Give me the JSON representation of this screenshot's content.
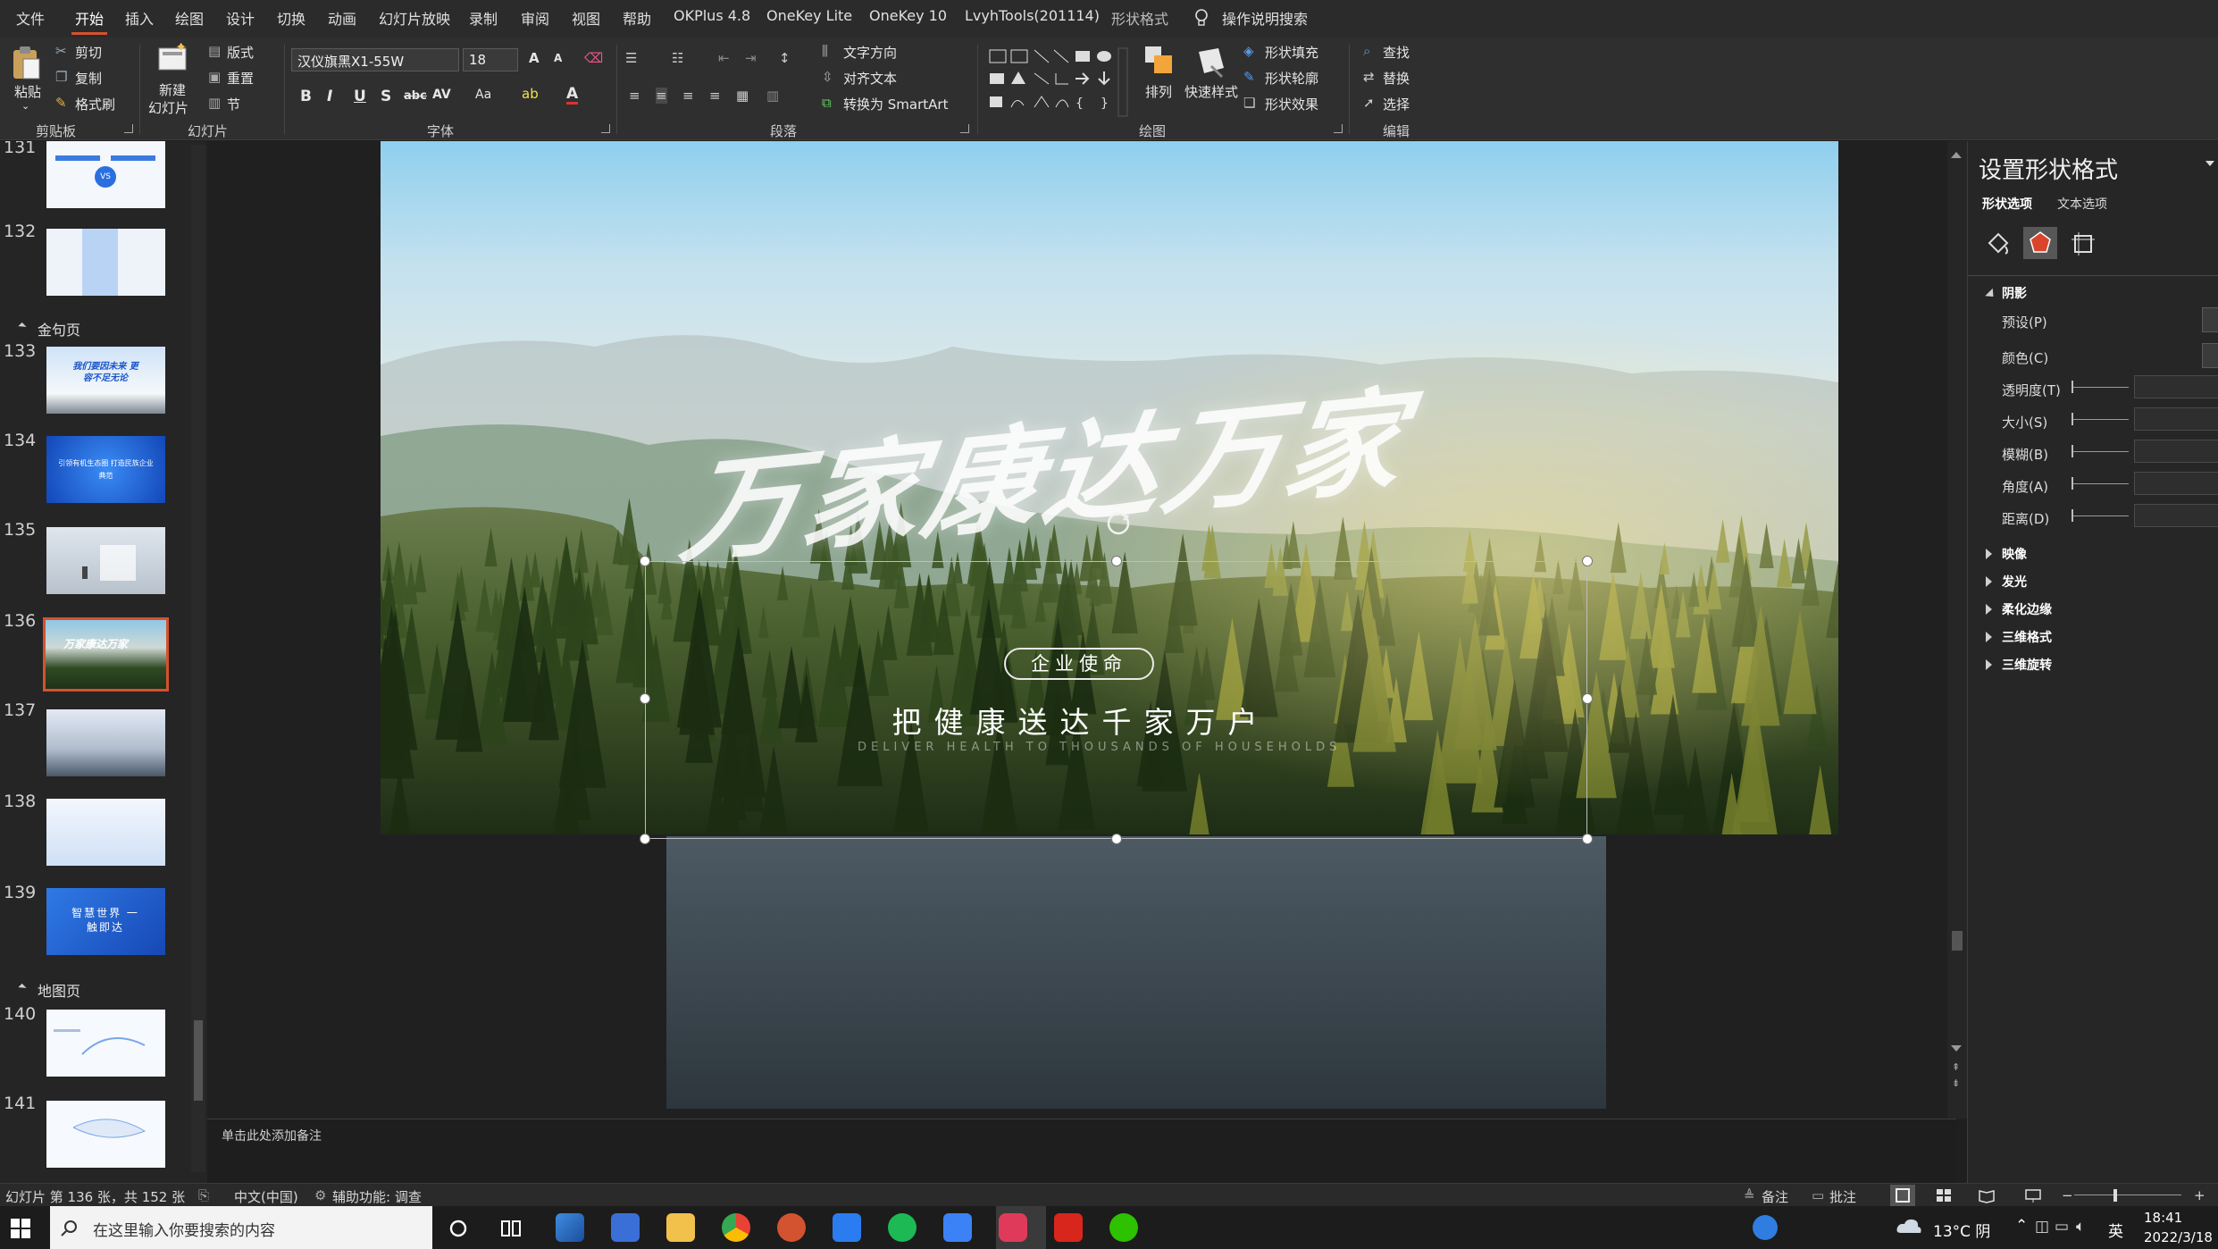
{
  "menu": {
    "items": [
      "文件",
      "开始",
      "插入",
      "绘图",
      "设计",
      "切换",
      "动画",
      "幻灯片放映",
      "录制",
      "审阅",
      "视图",
      "帮助",
      "OKPlus 4.8",
      "OneKey Lite",
      "OneKey 10",
      "LvyhTools(201114)",
      "形状格式"
    ],
    "search": "操作说明搜索"
  },
  "ribbon": {
    "clipboard": {
      "paste": "粘贴",
      "cut": "剪切",
      "copy": "复制",
      "format_painter": "格式刷",
      "label": "剪贴板"
    },
    "slides": {
      "new_slide": "新建",
      "new_slide_2": "幻灯片",
      "layout": "版式",
      "reset": "重置",
      "section": "节",
      "label": "幻灯片"
    },
    "font": {
      "name": "汉仪旗黑X1-55W",
      "size": "18",
      "label": "字体",
      "btn_bold": "B",
      "btn_italic": "I",
      "btn_underline": "U",
      "btn_strike": "S",
      "btn_abc": "abc",
      "btn_av": "AV",
      "btn_aa": "Aa",
      "btn_grow": "A",
      "btn_shrink": "A",
      "btn_color": "A"
    },
    "paragraph": {
      "text_direction": "文字方向",
      "align_text": "对齐文本",
      "convert_smartart": "转换为 SmartArt",
      "label": "段落"
    },
    "drawing": {
      "arrange": "排列",
      "quick_styles": "快速样式",
      "shape_fill": "形状填充",
      "shape_outline": "形状轮廓",
      "shape_effects": "形状效果",
      "label": "绘图"
    },
    "editing": {
      "find": "查找",
      "replace": "替换",
      "select": "选择",
      "label": "编辑"
    }
  },
  "thumbnails": {
    "sections": {
      "quote": "金句页",
      "map": "地图页"
    },
    "slides": [
      {
        "num": "131",
        "text": "VS"
      },
      {
        "num": "132",
        "text": ""
      },
      {
        "num": "133",
        "text": "我们要因未来 更容不足无论"
      },
      {
        "num": "134",
        "text": "引领有机生态圈 打造民族企业典范"
      },
      {
        "num": "135",
        "text": ""
      },
      {
        "num": "136",
        "text": "万家康达万家"
      },
      {
        "num": "137",
        "text": ""
      },
      {
        "num": "138",
        "text": ""
      },
      {
        "num": "139",
        "text": "智慧世界 一触即达"
      },
      {
        "num": "140",
        "text": ""
      },
      {
        "num": "141",
        "text": ""
      }
    ]
  },
  "slide": {
    "calligraphy": "万家康达万家",
    "badge": "企业使命",
    "headline": "把健康送达千家万户",
    "subline": "DELIVER HEALTH TO THOUSANDS OF HOUSEHOLDS"
  },
  "notes": {
    "placeholder": "单击此处添加备注"
  },
  "format_pane": {
    "title": "设置形状格式",
    "tab_shape": "形状选项",
    "tab_text": "文本选项",
    "shadow": "阴影",
    "preset": "预设(P)",
    "color": "颜色(C)",
    "transparency": "透明度(T)",
    "size": "大小(S)",
    "blur": "模糊(B)",
    "angle": "角度(A)",
    "distance": "距离(D)",
    "reflection": "映像",
    "glow": "发光",
    "soft_edges": "柔化边缘",
    "three_d_format": "三维格式",
    "three_d_rotation": "三维旋转"
  },
  "status": {
    "slide_info": "幻灯片 第 136 张，共 152 张",
    "language": "中文(中国)",
    "accessibility": "辅助功能: 调查",
    "notes": "备注",
    "comments": "批注"
  },
  "taskbar": {
    "search_placeholder": "在这里输入你要搜索的内容",
    "weather": "13°C 阴",
    "ime": "英",
    "time": "18:41",
    "date": "2022/3/18"
  },
  "colors": {
    "accent": "#d35230",
    "selection": "#d35230"
  }
}
